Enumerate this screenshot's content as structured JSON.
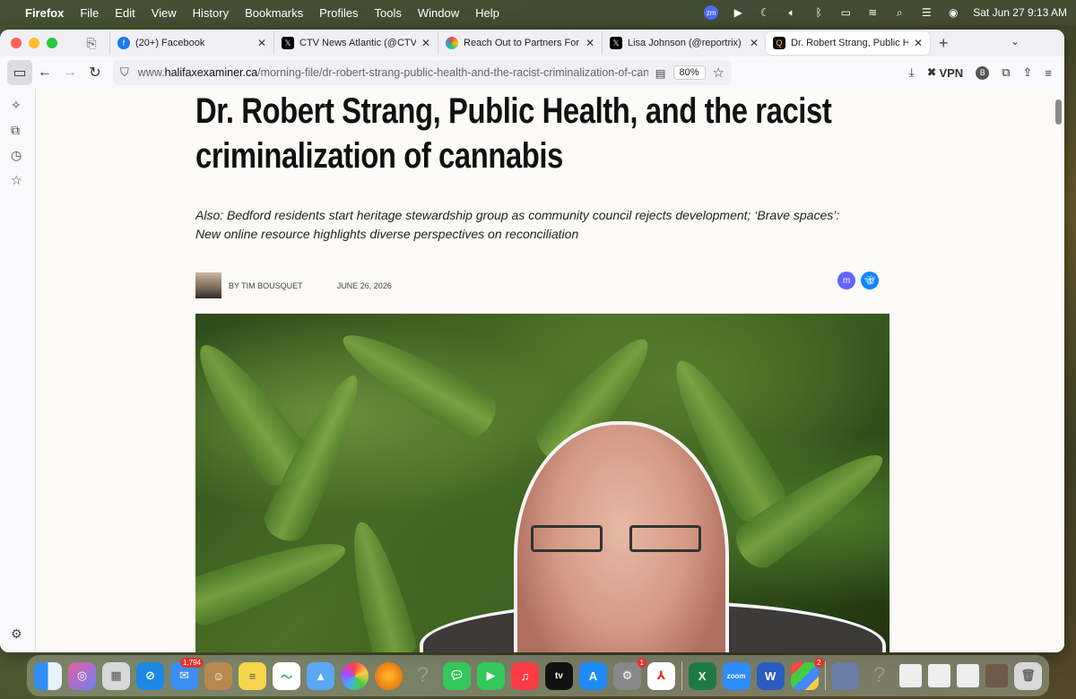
{
  "menubar": {
    "app_name": "Firefox",
    "items": [
      "File",
      "Edit",
      "View",
      "History",
      "Bookmarks",
      "Profiles",
      "Tools",
      "Window",
      "Help"
    ],
    "clock": "Sat Jun 27  9:13 AM",
    "zoom_icon_text": "zm"
  },
  "tabs": [
    {
      "label": "(20+) Facebook",
      "favicon": "facebook-icon"
    },
    {
      "label": "CTV News Atlantic (@CTVAtlant",
      "favicon": "x-icon"
    },
    {
      "label": "Reach Out to Partners For Youth",
      "favicon": "reach-icon"
    },
    {
      "label": "Lisa Johnson (@reportrix) / X",
      "favicon": "x-icon"
    },
    {
      "label": "Dr. Robert Strang, Public Health",
      "favicon": "halifax-examiner-icon",
      "active": true
    }
  ],
  "urlbar": {
    "prefix": "www.",
    "domain": "halifaxexaminer.ca",
    "path": "/morning-file/dr-robert-strang-public-health-and-the-racist-criminalization-of-cannabis",
    "zoom": "80%"
  },
  "toolbar": {
    "vpn_label": "VPN",
    "profile_letter": "B"
  },
  "article": {
    "title": "Dr. Robert Strang, Public Health, and the racist criminalization of cannabis",
    "subtitle": "Also: Bedford residents start heritage stewardship group as community council rejects development; ‘Brave spaces’: New online resource highlights diverse perspectives on reconciliation",
    "byline": "BY TIM BOUSQUET",
    "date": "JUNE 26, 2026"
  },
  "dock": {
    "mail_badge": "1,794",
    "settings_badge": "1",
    "misc_badge": "2",
    "tv_label": "tv",
    "zoom_label": "zoom",
    "word_label": "W",
    "excel_label": "X"
  },
  "colors": {
    "accent_blue": "#1877f2",
    "mastodon": "#6364ff",
    "bluesky": "#1185fe"
  }
}
